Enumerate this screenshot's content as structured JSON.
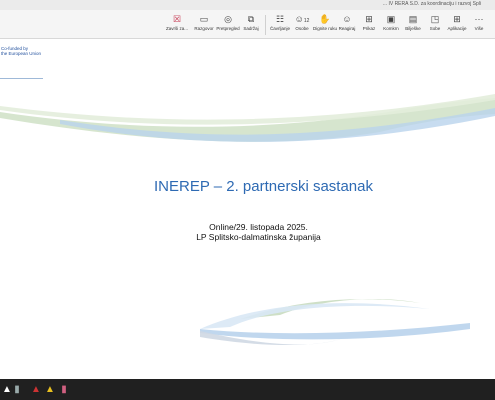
{
  "window": {
    "title": "... IV RERA S.D. za koordinaciju i razvoj Spli"
  },
  "toolbar": {
    "items": [
      {
        "label": "Završi za...",
        "icon": "leave-icon",
        "glyph": "☒"
      },
      {
        "label": "Razgovor",
        "icon": "chat-icon",
        "glyph": "▭"
      },
      {
        "label": "Pretpregled",
        "icon": "eye-icon",
        "glyph": "◎"
      },
      {
        "label": "Sadržaj",
        "icon": "share-content-icon",
        "glyph": "⧉"
      },
      {
        "label": "Čavrljanje",
        "icon": "chat-bubble-icon",
        "glyph": "☷"
      },
      {
        "label": "Osobe",
        "icon": "people-icon",
        "glyph": "☺",
        "count": "12"
      },
      {
        "label": "Dignite ruku",
        "icon": "raise-hand-icon",
        "glyph": "✋"
      },
      {
        "label": "Reagiraj",
        "icon": "react-icon",
        "glyph": "☺"
      },
      {
        "label": "Prikaz",
        "icon": "view-icon",
        "glyph": "⊞"
      },
      {
        "label": "Komkrn",
        "icon": "camera-icon",
        "glyph": "▣"
      },
      {
        "label": "Bilješke",
        "icon": "notes-icon",
        "glyph": "▤"
      },
      {
        "label": "Sobe",
        "icon": "rooms-icon",
        "glyph": "◳"
      },
      {
        "label": "Aplikacije",
        "icon": "apps-icon",
        "glyph": "⊞"
      },
      {
        "label": "Više",
        "icon": "more-icon",
        "glyph": "···"
      }
    ]
  },
  "slide": {
    "logo_text_line1": "Co-funded by",
    "logo_text_line2": "the European Union",
    "title": "INEREP – 2. partnerski sastanak",
    "subtitle_line1": "Online/29. listopada 2025.",
    "subtitle_line2": "LP Splitsko-dalmatinska županija",
    "colors": {
      "title": "#2e6ab3",
      "wave_green": "#c9dcc0",
      "wave_blue": "#b9d3ec"
    }
  },
  "taskbar": {
    "items": [
      {
        "icon": "start-icon"
      },
      {
        "icon": "trash-icon"
      },
      {
        "icon": "app-icon-1"
      },
      {
        "icon": "app-icon-2"
      },
      {
        "icon": "app-icon-3"
      }
    ]
  }
}
